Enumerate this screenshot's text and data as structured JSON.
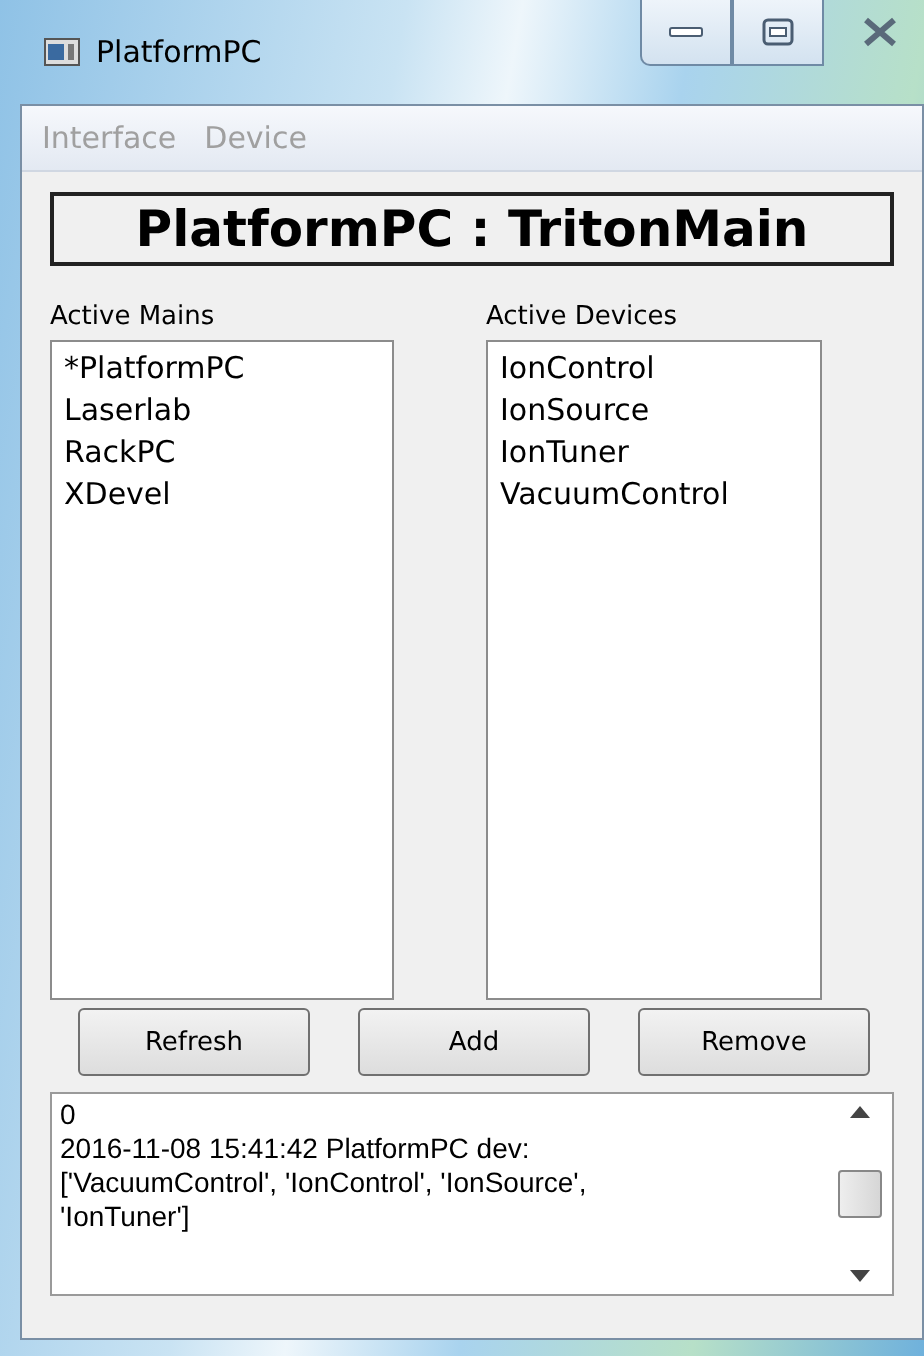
{
  "window": {
    "title": "PlatformPC"
  },
  "menu": [
    {
      "label": "Interface",
      "disabled": true
    },
    {
      "label": "Device",
      "disabled": true
    }
  ],
  "heading": "PlatformPC : TritonMain",
  "mains": {
    "label": "Active Mains",
    "items": [
      "*PlatformPC",
      "Laserlab",
      "RackPC",
      "XDevel"
    ]
  },
  "devices": {
    "label": "Active Devices",
    "items": [
      "IonControl",
      "IonSource",
      "IonTuner",
      "VacuumControl"
    ]
  },
  "buttons": [
    "Refresh",
    "Add",
    "Remove"
  ],
  "log": [
    "0",
    "2016-11-08 15:41:42 PlatformPC dev:",
    "['VacuumControl', 'IonControl', 'IonSource',",
    "'IonTuner']"
  ]
}
